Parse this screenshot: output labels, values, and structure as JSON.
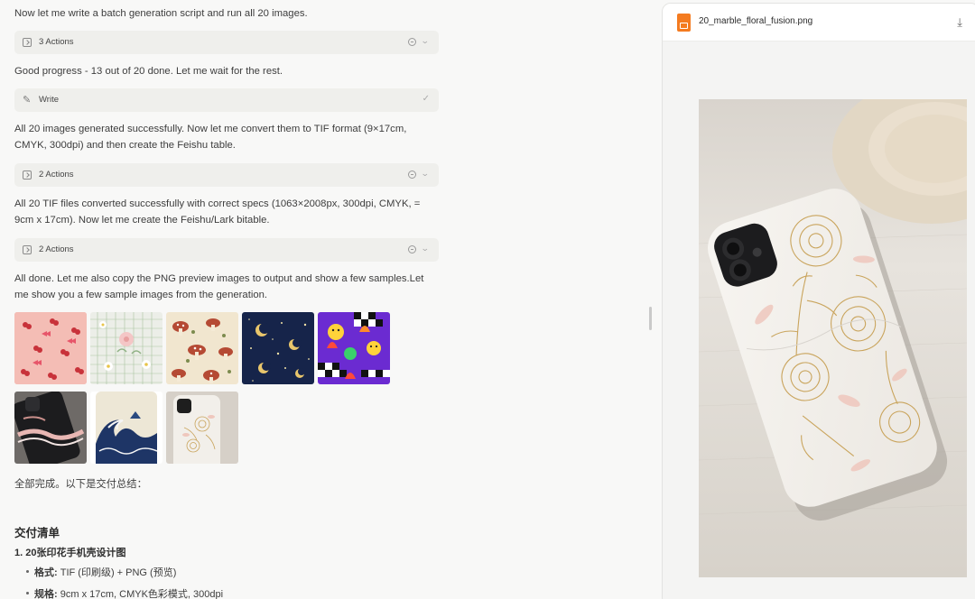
{
  "messages": {
    "m1": "Now let me write a batch generation script and run all 20 images.",
    "m2": "Good progress - 13 out of 20 done. Let me wait for the rest.",
    "m3a": "All 20 images generated successfully. Now let me convert them to TIF format (9×17cm,",
    "m3b": "CMYK, 300dpi) and then create the Feishu table.",
    "m4a": "All 20 TIF files converted successfully with correct specs (1063×2008px, 300dpi, CMYK, =",
    "m4b": "9cm x 17cm). Now let me create the Feishu/Lark bitable.",
    "m5a": "All done. Let me also copy the PNG preview images to output and show a few samples.Let",
    "m5b": "me show you a few sample images from the generation.",
    "m6": "全部完成。以下是交付总结："
  },
  "actions": {
    "a1": "3 Actions",
    "a2": "Write",
    "a3": "2 Actions",
    "a4": "2 Actions"
  },
  "summary": {
    "title": "交付清单",
    "item1": "1. 20张印花手机壳设计图",
    "b1_label": "格式:",
    "b1_value": "TIF (印刷级) + PNG (预览)",
    "b2_label": "规格:",
    "b2_value": "9cm x 17cm, CMYK色彩模式, 300dpi"
  },
  "preview": {
    "filename": "20_marble_floral_fusion.png"
  },
  "icons": {
    "file": "image-file-icon",
    "download": "download-icon",
    "action": "terminal-icon",
    "write": "pencil-icon"
  },
  "colors": {
    "accent": "#f47b20",
    "panel_bg": "#efefec"
  }
}
